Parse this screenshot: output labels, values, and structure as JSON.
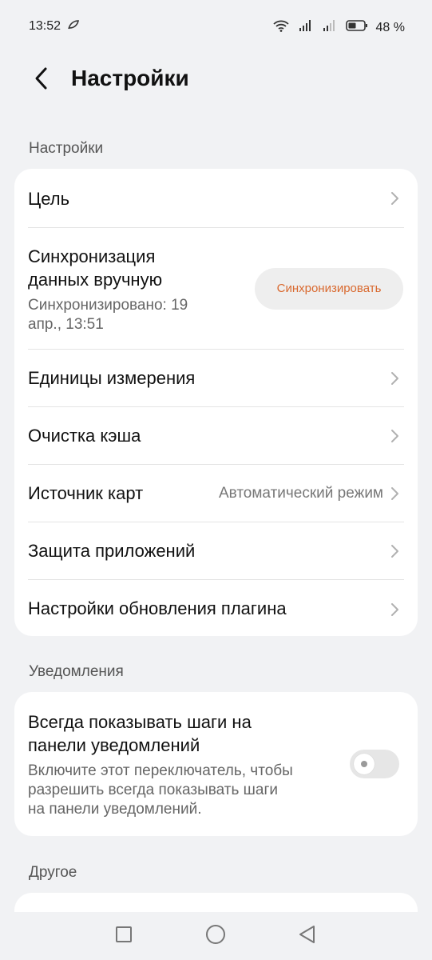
{
  "status_bar": {
    "time": "13:52",
    "battery": "48 %",
    "icons": [
      "leaf-icon",
      "wifi-icon",
      "signal-icon",
      "signal-icon",
      "battery-icon"
    ]
  },
  "header": {
    "title": "Настройки",
    "back_icon": "chevron-left-icon"
  },
  "sections": {
    "settings": {
      "label": "Настройки",
      "items": [
        {
          "title": "Цель"
        },
        {
          "title_line1": "Синхронизация",
          "title_line2": "данных вручную",
          "sub_line1": "Синхронизировано: 19",
          "sub_line2": "апр., 13:51",
          "button": "Синхронизировать"
        },
        {
          "title": "Единицы измерения"
        },
        {
          "title": "Очистка кэша"
        },
        {
          "title": "Источник карт",
          "value": "Автоматический режим"
        },
        {
          "title": "Защита приложений"
        },
        {
          "title": "Настройки обновления плагина"
        }
      ]
    },
    "notifications": {
      "label": "Уведомления",
      "item": {
        "title_line1": "Всегда показывать шаги на",
        "title_line2": "панели уведомлений",
        "desc_line1": "Включите этот переключатель, чтобы",
        "desc_line2": "разрешить всегда показывать шаги",
        "desc_line3": "на панели уведомлений.",
        "toggle_on": false
      }
    },
    "other": {
      "label": "Другое"
    }
  },
  "colors": {
    "accent": "#d9692f",
    "background": "#f1f2f4"
  },
  "navbar": {
    "icons": [
      "square-icon",
      "circle-icon",
      "triangle-back-icon"
    ]
  }
}
